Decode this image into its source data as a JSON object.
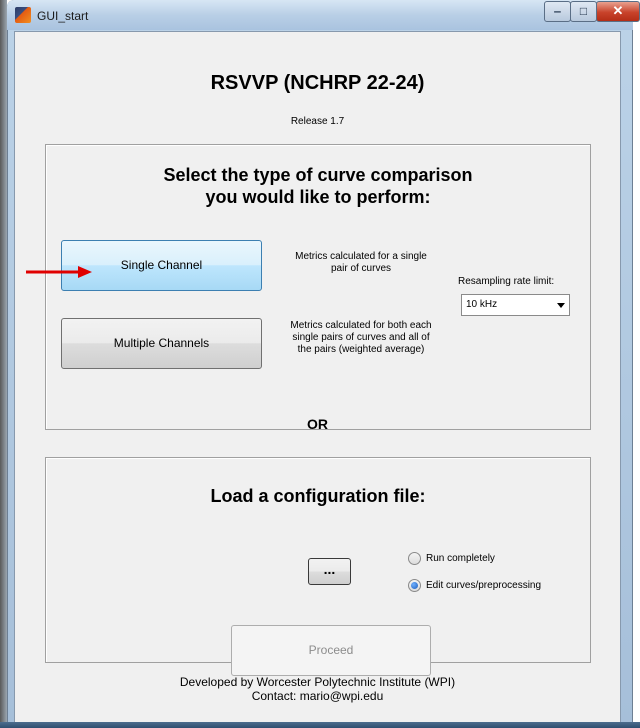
{
  "window": {
    "title": "GUI_start",
    "controls": {
      "minimize": "‒",
      "maximize": "□",
      "close": "✕"
    }
  },
  "header": {
    "title": "RSVVP (NCHRP 22-24)",
    "release": "Release 1.7"
  },
  "comparison_panel": {
    "heading_line1": "Select the type of curve comparison",
    "heading_line2": "you would like to perform:",
    "single_button": "Single Channel",
    "single_desc_line1": "Metrics calculated for a single",
    "single_desc_line2": "pair of curves",
    "multi_button": "Multiple Channels",
    "multi_desc_line1": "Metrics calculated for both each",
    "multi_desc_line2": "single pairs of curves and all of",
    "multi_desc_line3": "the pairs (weighted average)",
    "resampling_label": "Resampling rate limit:",
    "resampling_value": "10 kHz"
  },
  "or_label": "OR",
  "config_panel": {
    "heading": "Load a  configuration file:",
    "browse_button": "...",
    "radio_run": "Run completely",
    "radio_edit": "Edit curves/preprocessing",
    "selected_radio": "Edit curves/preprocessing",
    "proceed_button": "Proceed"
  },
  "footer": {
    "line1": "Developed by Worcester Polytechnic Institute (WPI)",
    "line2": "Contact: mario@wpi.edu"
  },
  "colors": {
    "annotation_arrow": "#e00000",
    "highlight_button": "#a7d9f5"
  },
  "icons": {
    "app": "matlab-icon",
    "annotation": "red-arrow-icon"
  }
}
